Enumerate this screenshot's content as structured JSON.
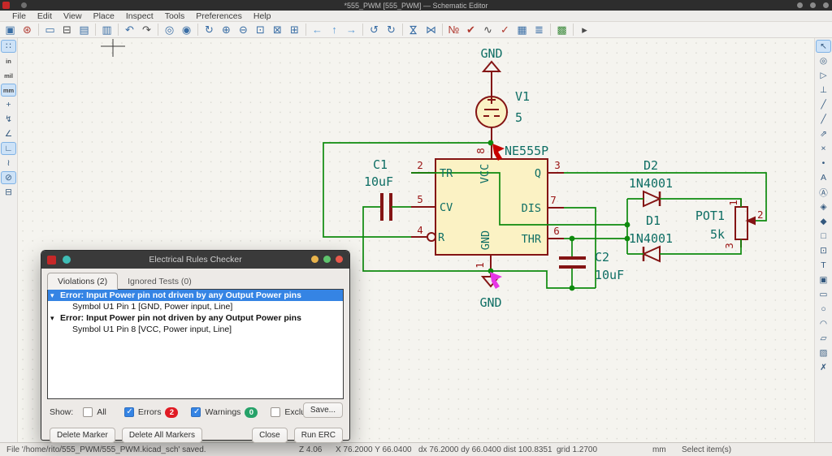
{
  "window": {
    "title": "*555_PWM [555_PWM] — Schematic Editor"
  },
  "menu": {
    "items": [
      "File",
      "Edit",
      "View",
      "Place",
      "Inspect",
      "Tools",
      "Preferences",
      "Help"
    ]
  },
  "toolbar": {
    "icons": [
      {
        "n": "save",
        "g": "▣"
      },
      {
        "n": "schematic-setup",
        "g": "⊛"
      },
      {
        "n": "page-settings",
        "g": "▭"
      },
      {
        "n": "print",
        "g": "⊟"
      },
      {
        "n": "plot",
        "g": "▤"
      },
      {
        "n": "paste",
        "g": "▥"
      },
      {
        "n": "undo",
        "g": "↶"
      },
      {
        "n": "redo",
        "g": "↷"
      },
      {
        "n": "find",
        "g": "◎"
      },
      {
        "n": "find-replace",
        "g": "◉"
      },
      {
        "n": "refresh",
        "g": "↻"
      },
      {
        "n": "zoom-in",
        "g": "⊕"
      },
      {
        "n": "zoom-out",
        "g": "⊖"
      },
      {
        "n": "zoom-fit",
        "g": "⊡"
      },
      {
        "n": "zoom-objects",
        "g": "⊠"
      },
      {
        "n": "zoom-selection",
        "g": "⊞"
      },
      {
        "n": "nav-back",
        "g": "←"
      },
      {
        "n": "nav-up",
        "g": "↑"
      },
      {
        "n": "nav-forward",
        "g": "→"
      },
      {
        "n": "rotate-ccw",
        "g": "↺"
      },
      {
        "n": "rotate-cw",
        "g": "↻"
      },
      {
        "n": "mirror-vertical",
        "g": "⋈"
      },
      {
        "n": "mirror-horizontal",
        "g": "⋈"
      },
      {
        "n": "annotate",
        "g": "№"
      },
      {
        "n": "erc",
        "g": "✔"
      },
      {
        "n": "simulator",
        "g": "∿"
      },
      {
        "n": "symbol-checker",
        "g": "✓"
      },
      {
        "n": "fields-table",
        "g": "▦"
      },
      {
        "n": "bom",
        "g": "≣"
      },
      {
        "n": "pcb-editor",
        "g": "▩"
      },
      {
        "n": "scripting-console",
        "g": "▸"
      }
    ]
  },
  "left_toolbar": {
    "icons": [
      {
        "n": "grid-toggle",
        "g": "∷"
      },
      {
        "n": "units-inch",
        "g": "in"
      },
      {
        "n": "units-mil",
        "g": "mil"
      },
      {
        "n": "units-mm",
        "g": "mm"
      },
      {
        "n": "crosshair-style",
        "g": "+"
      },
      {
        "n": "hidden-pins-toggle",
        "g": "↯"
      },
      {
        "n": "line-angle-45",
        "g": "∠"
      },
      {
        "n": "line-angle-90",
        "g": "∟"
      },
      {
        "n": "line-angle-free",
        "g": "≀"
      },
      {
        "n": "erc-exclusions-toggle",
        "g": "⊘"
      },
      {
        "n": "hierarchy-navigator",
        "g": "⊟"
      }
    ]
  },
  "right_toolbar": {
    "icons": [
      {
        "n": "select-tool",
        "g": "↖"
      },
      {
        "n": "highlight-net",
        "g": "◎"
      },
      {
        "n": "add-symbol",
        "g": "▷"
      },
      {
        "n": "add-power",
        "g": "⊥"
      },
      {
        "n": "draw-wire",
        "g": "╱"
      },
      {
        "n": "draw-bus",
        "g": "╱"
      },
      {
        "n": "wire-to-bus-entry",
        "g": "⇗"
      },
      {
        "n": "no-connect-flag",
        "g": "×"
      },
      {
        "n": "junction",
        "g": "•"
      },
      {
        "n": "net-label",
        "g": "A"
      },
      {
        "n": "net-class-directive",
        "g": "Ⓐ"
      },
      {
        "n": "global-label",
        "g": "◈"
      },
      {
        "n": "hierarchical-label",
        "g": "◆"
      },
      {
        "n": "hierarchical-sheet",
        "g": "□"
      },
      {
        "n": "import-sheet-pin",
        "g": "⊡"
      },
      {
        "n": "text",
        "g": "T"
      },
      {
        "n": "text-box",
        "g": "▣"
      },
      {
        "n": "rectangle",
        "g": "▭"
      },
      {
        "n": "circle",
        "g": "○"
      },
      {
        "n": "arc",
        "g": "◠"
      },
      {
        "n": "polygon",
        "g": "▱"
      },
      {
        "n": "image",
        "g": "▨"
      },
      {
        "n": "delete-tool",
        "g": "✗"
      }
    ]
  },
  "schematic": {
    "gnd_top": "GND",
    "v1_ref": "V1",
    "v1_value": "5",
    "ic_value": "NE555P",
    "pins": {
      "trig_num": "2",
      "trig_name": "TR",
      "cv_num": "5",
      "cv_name": "CV",
      "rst_num": "4",
      "rst_name": "R",
      "out_num": "3",
      "out_name": "Q",
      "dis_num": "7",
      "dis_name": "DIS",
      "thr_num": "6",
      "thr_name": "THR",
      "vcc_num": "8",
      "vcc_name": "VCC",
      "gnd_num": "1",
      "gnd_name": "GND"
    },
    "c1_ref": "C1",
    "c1_value": "10uF",
    "c2_ref": "C2",
    "c2_value": "10uF",
    "d1_ref": "D1",
    "d1_value": "1N4001",
    "d2_ref": "D2",
    "d2_value": "1N4001",
    "pot_ref": "POT1",
    "pot_value": "5k",
    "pot_pin1": "1",
    "pot_pin2": "2",
    "pot_pin3": "3",
    "gnd_bottom": "GND"
  },
  "dialog": {
    "title": "Electrical Rules Checker",
    "expander_glyph": "▾",
    "tabs": [
      {
        "label": "Violations (2)"
      },
      {
        "label": "Ignored Tests (0)"
      }
    ],
    "violations": [
      {
        "message": "Error: Input Power pin not driven by any Output Power pins",
        "detail": "Symbol U1 Pin 1 [GND, Power input, Line]",
        "selected": true
      },
      {
        "message": "Error: Input Power pin not driven by any Output Power pins",
        "detail": "Symbol U1 Pin 8 [VCC, Power input, Line]",
        "selected": false
      }
    ],
    "show_label": "Show:",
    "filters": [
      {
        "label": "All",
        "checked": false,
        "badge": null
      },
      {
        "label": "Errors",
        "checked": true,
        "badge": "2"
      },
      {
        "label": "Warnings",
        "checked": true,
        "badge": "0"
      },
      {
        "label": "Exclusions",
        "checked": false,
        "badge": null
      }
    ],
    "buttons": {
      "save": "Save...",
      "delete_marker": "Delete Marker",
      "delete_all": "Delete All Markers",
      "close": "Close",
      "run": "Run ERC"
    }
  },
  "status_bar": {
    "message": "File '/home/rito/555_PWM/555_PWM.kicad_sch' saved.",
    "zoom": "Z 4.06",
    "position": "X 76.2000  Y 66.0400",
    "delta": "dx 76.2000  dy 66.0400  dist 100.8351",
    "grid": "grid 1.2700",
    "units": "mm",
    "hint": "Select item(s)"
  },
  "colors": {
    "titlebar": "#2D2D2D",
    "canvas": "#F5F4EF",
    "selection_blue": "#3584E4",
    "error_red": "#E01B24",
    "warning_green": "#26A269",
    "wire_green": "#0E8A0E",
    "symbol_maroon": "#841414",
    "field_teal": "#0E6E64",
    "pin_number_red": "#9A1515",
    "body_yellow": "#FBF2C4",
    "marker_red": "#C80000",
    "marker_magenta": "#E637E6"
  }
}
